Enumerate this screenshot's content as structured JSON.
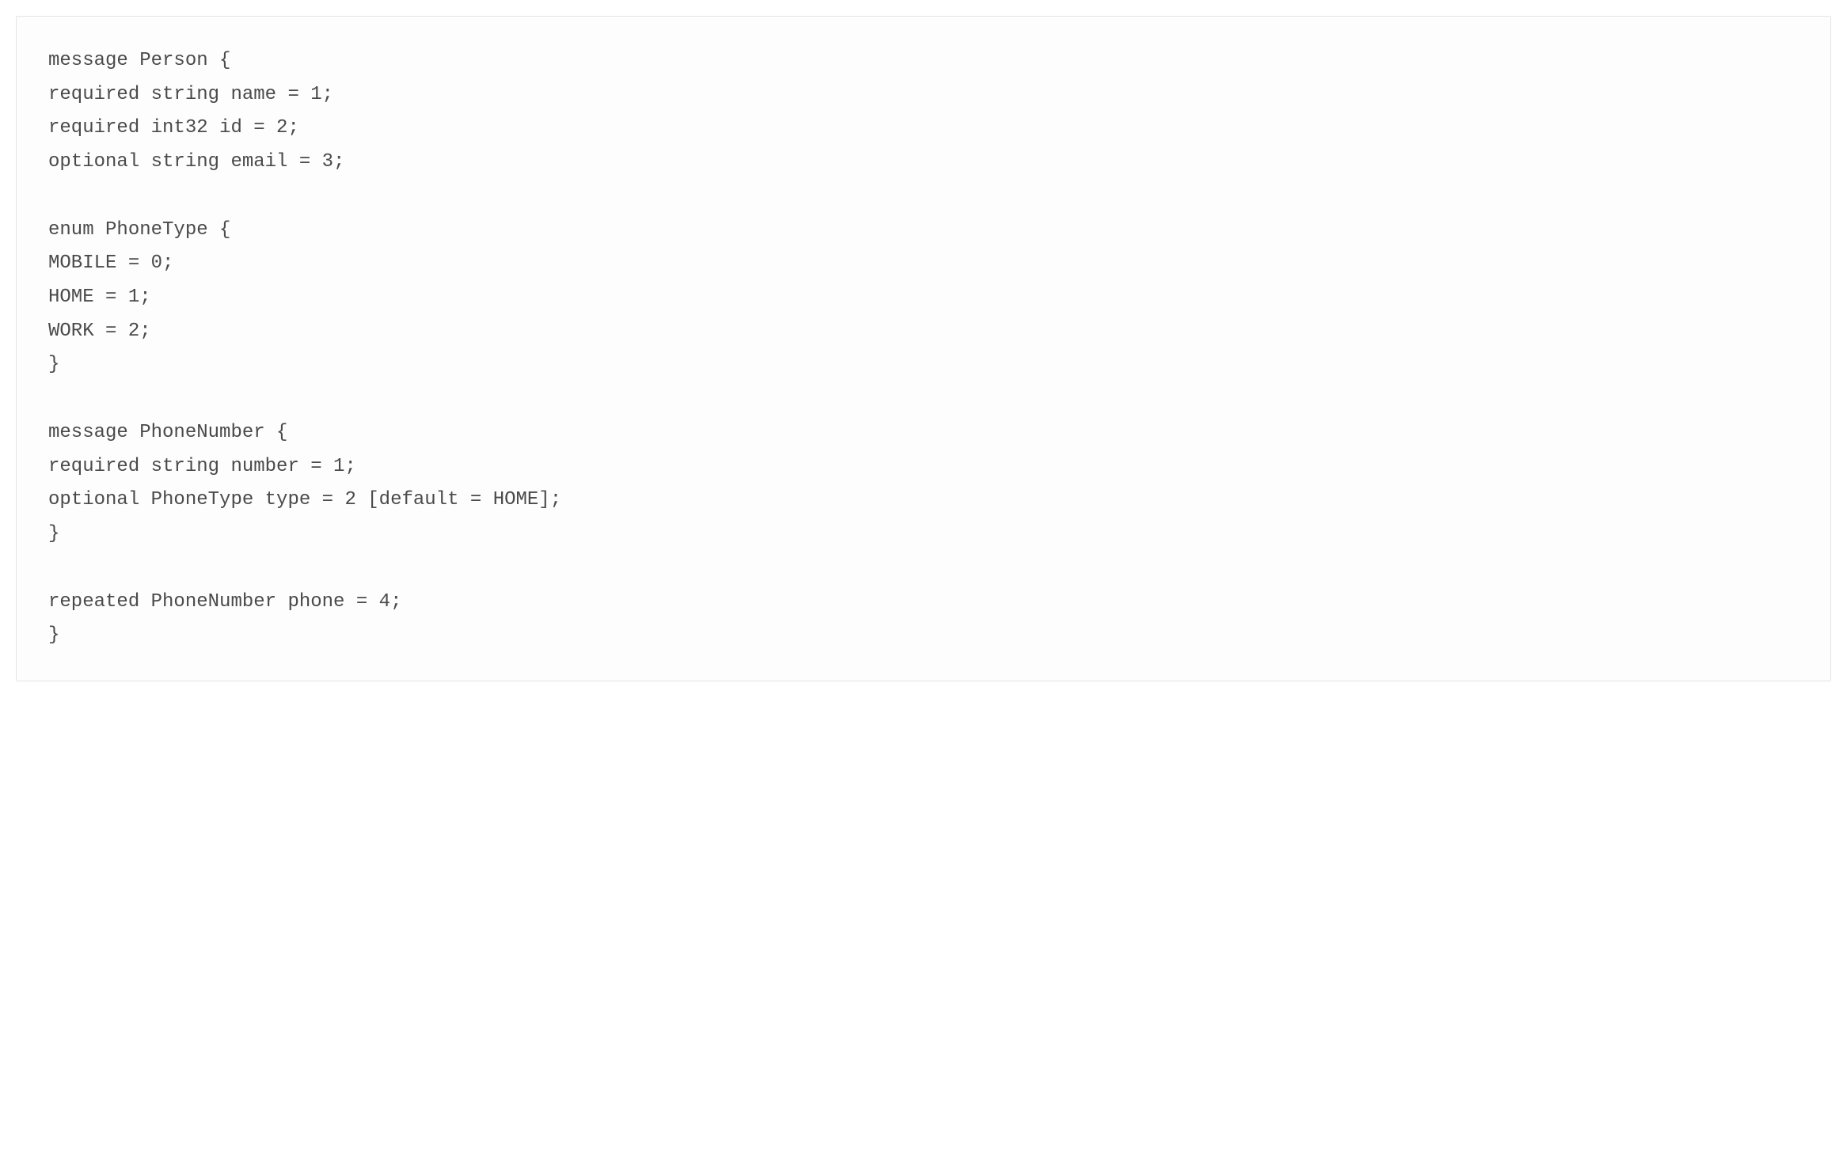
{
  "code": {
    "lines": [
      "message Person {",
      "required string name = 1;",
      "required int32 id = 2;",
      "optional string email = 3;",
      "",
      "enum PhoneType {",
      "MOBILE = 0;",
      "HOME = 1;",
      "WORK = 2;",
      "}",
      "",
      "message PhoneNumber {",
      "required string number = 1;",
      "optional PhoneType type = 2 [default = HOME];",
      "}",
      "",
      "repeated PhoneNumber phone = 4;",
      "}"
    ]
  }
}
